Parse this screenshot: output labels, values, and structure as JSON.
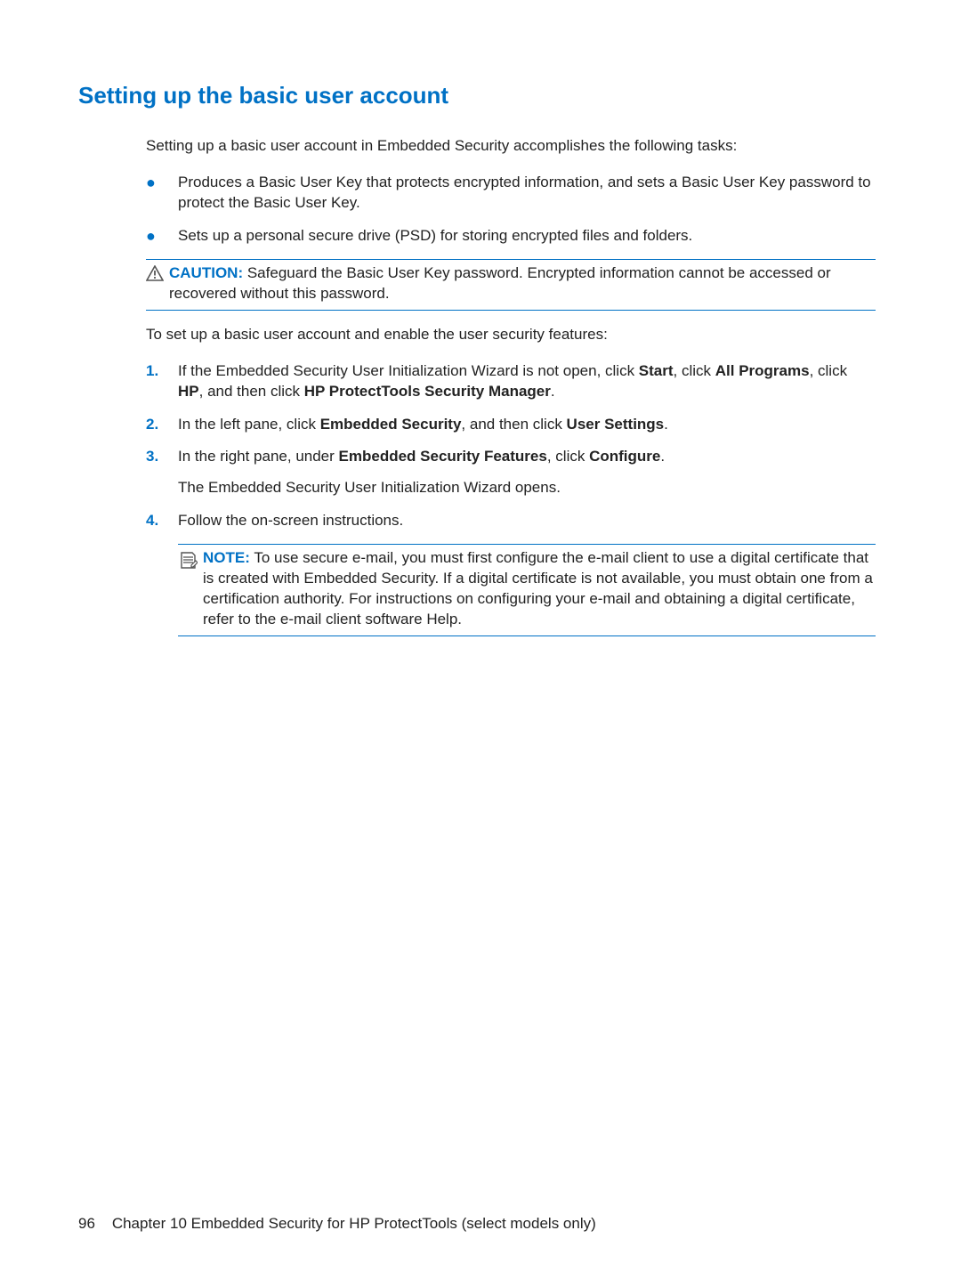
{
  "title": "Setting up the basic user account",
  "intro": "Setting up a basic user account in Embedded Security accomplishes the following tasks:",
  "bullets": [
    "Produces a Basic User Key that protects encrypted information, and sets a Basic User Key password to protect the Basic User Key.",
    "Sets up a personal secure drive (PSD) for storing encrypted files and folders."
  ],
  "caution": {
    "label": "CAUTION:",
    "text": "Safeguard the Basic User Key password. Encrypted information cannot be accessed or recovered without this password."
  },
  "lead": "To set up a basic user account and enable the user security features:",
  "steps": {
    "s1_parts": {
      "a": "If the Embedded Security User Initialization Wizard is not open, click ",
      "b": ", click ",
      "c": ", click ",
      "d": ", and then click ",
      "e": ".",
      "start": "Start",
      "allprograms": "All Programs",
      "hp": "HP",
      "mgr": "HP ProtectTools Security Manager"
    },
    "s2_parts": {
      "a": "In the left pane, click ",
      "b": ", and then click ",
      "c": ".",
      "es": "Embedded Security",
      "us": "User Settings"
    },
    "s3_parts": {
      "a": "In the right pane, under ",
      "b": ", click ",
      "c": ".",
      "esf": "Embedded Security Features",
      "cfg": "Configure"
    },
    "s3_tail": "The Embedded Security User Initialization Wizard opens.",
    "s4": "Follow the on-screen instructions."
  },
  "note": {
    "label": "NOTE:",
    "text": "To use secure e-mail, you must first configure the e-mail client to use a digital certificate that is created with Embedded Security. If a digital certificate is not available, you must obtain one from a certification authority. For instructions on configuring your e-mail and obtaining a digital certificate, refer to the e-mail client software Help."
  },
  "footer": {
    "page": "96",
    "chapter": "Chapter 10   Embedded Security for HP ProtectTools (select models only)"
  }
}
